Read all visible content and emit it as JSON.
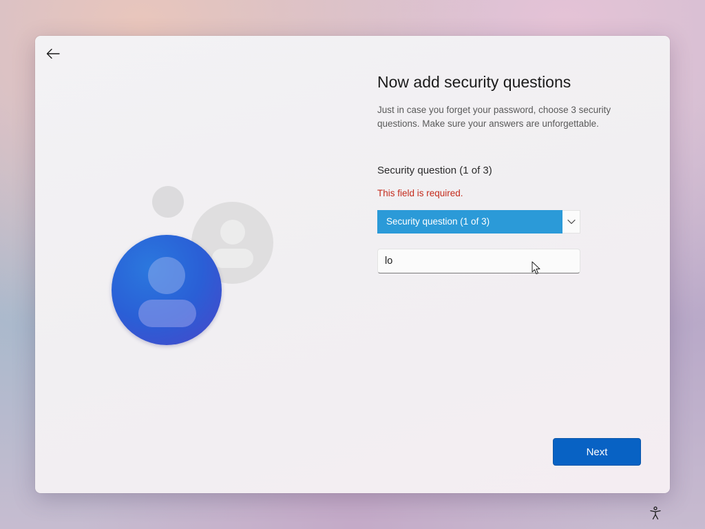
{
  "header": {
    "back_icon": "back-arrow-icon"
  },
  "main": {
    "title": "Now add security questions",
    "subtitle": "Just in case you forget your password, choose 3 security questions. Make sure your answers are unforgettable.",
    "section_label": "Security question (1 of 3)",
    "error_message": "This field is required.",
    "question_dropdown": {
      "selected": "Security question (1 of 3)"
    },
    "answer_field": {
      "value": "lo"
    }
  },
  "footer": {
    "next_label": "Next",
    "accessibility_icon": "accessibility-icon"
  },
  "colors": {
    "accent": "#0862c4",
    "dropdown_highlight": "#2b9ad8",
    "error": "#c42b1c"
  }
}
